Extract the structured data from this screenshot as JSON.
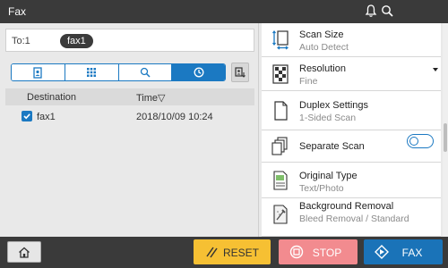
{
  "header": {
    "title": "Fax"
  },
  "recipient": {
    "to_label": "To:1",
    "chip": "fax1"
  },
  "tabs": [
    {
      "icon": "address-book-icon"
    },
    {
      "icon": "keypad-icon"
    },
    {
      "icon": "search-icon"
    },
    {
      "icon": "history-icon",
      "active": true
    }
  ],
  "list": {
    "headers": {
      "destination": "Destination",
      "time": "Time▽"
    },
    "rows": [
      {
        "name": "fax1",
        "time": "2018/10/09  10:24",
        "checked": true
      }
    ]
  },
  "settings": [
    {
      "title": "Scan Size",
      "value": "Auto Detect",
      "icon": "scan-size-icon"
    },
    {
      "title": "Resolution",
      "value": "Fine",
      "icon": "resolution-icon"
    },
    {
      "title": "Duplex Settings",
      "value": "1-Sided Scan",
      "icon": "duplex-icon"
    },
    {
      "title": "Separate Scan",
      "value": "",
      "icon": "separate-scan-icon",
      "toggle": "off"
    },
    {
      "title": "Original Type",
      "value": "Text/Photo",
      "icon": "original-type-icon"
    },
    {
      "title": "Background Removal",
      "value": "Bleed Removal / Standard",
      "icon": "background-removal-icon"
    }
  ],
  "footer": {
    "reset_label": "RESET",
    "stop_label": "STOP",
    "start_label": "FAX"
  },
  "colors": {
    "accent": "#1b79c2",
    "reset": "#f6c033",
    "stop": "#f28b8f",
    "start": "#1a73b8",
    "bar": "#3a3a3a"
  }
}
